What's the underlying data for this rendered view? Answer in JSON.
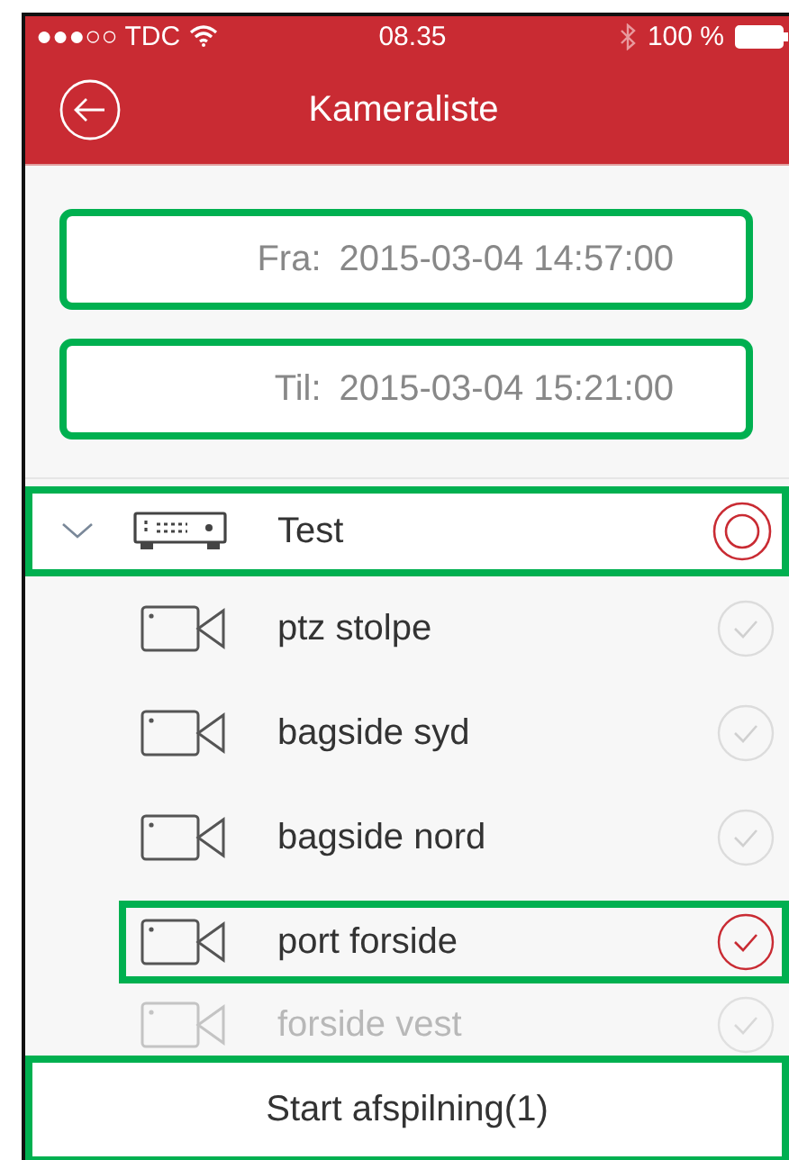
{
  "status_bar": {
    "carrier": "●●●○○ TDC",
    "time": "08.35",
    "battery": "100 %"
  },
  "nav": {
    "title": "Kameraliste"
  },
  "fields": [
    {
      "label": "Fra:",
      "value": "2015-03-04 14:57:00",
      "highlighted": true
    },
    {
      "label": "Til:",
      "value": "2015-03-04 15:21:00",
      "highlighted": true
    }
  ],
  "device": {
    "name": "Test",
    "expanded": true,
    "selected": true,
    "highlighted": true,
    "cameras": [
      {
        "name": "ptz stolpe",
        "selected": false,
        "highlighted": false
      },
      {
        "name": "bagside syd",
        "selected": false,
        "highlighted": false
      },
      {
        "name": "bagside nord",
        "selected": false,
        "highlighted": false
      },
      {
        "name": "port forside",
        "selected": true,
        "highlighted": true
      },
      {
        "name": "forside vest",
        "selected": false,
        "highlighted": false
      }
    ]
  },
  "play_button": {
    "label": "Start afspilning(1)",
    "highlighted": true
  }
}
